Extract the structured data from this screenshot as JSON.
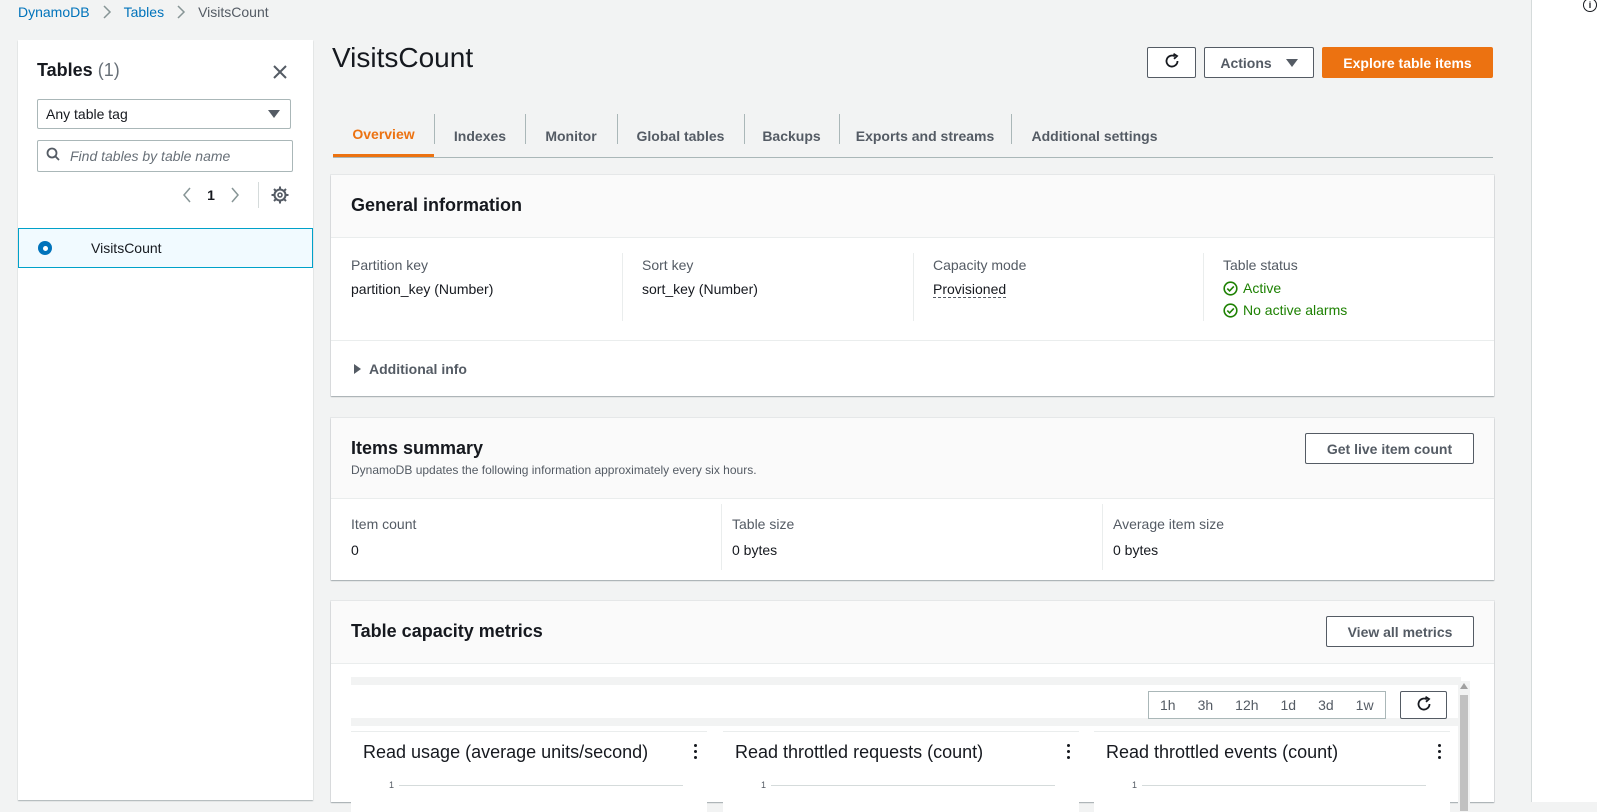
{
  "breadcrumb": {
    "items": [
      "DynamoDB",
      "Tables"
    ],
    "current": "VisitsCount"
  },
  "info_glyph": "i",
  "left_panel": {
    "title": "Tables",
    "count": "(1)",
    "tag_filter": "Any table tag",
    "search_placeholder": "Find tables by table name",
    "page": "1",
    "tables": [
      {
        "name": "VisitsCount",
        "selected": true
      }
    ]
  },
  "page": {
    "title": "VisitsCount"
  },
  "header_actions": {
    "actions_label": "Actions",
    "explore_label": "Explore table items"
  },
  "tabs": [
    "Overview",
    "Indexes",
    "Monitor",
    "Global tables",
    "Backups",
    "Exports and streams",
    "Additional settings"
  ],
  "active_tab": "Overview",
  "general_info": {
    "title": "General information",
    "partition_key": {
      "label": "Partition key",
      "value": "partition_key (Number)"
    },
    "sort_key": {
      "label": "Sort key",
      "value": "sort_key (Number)"
    },
    "capacity_mode": {
      "label": "Capacity mode",
      "value": "Provisioned"
    },
    "table_status": {
      "label": "Table status",
      "status": "Active",
      "alarms": "No active alarms"
    },
    "additional_info": "Additional info"
  },
  "items_summary": {
    "title": "Items summary",
    "description": "DynamoDB updates the following information approximately every six hours.",
    "button": "Get live item count",
    "item_count": {
      "label": "Item count",
      "value": "0"
    },
    "table_size": {
      "label": "Table size",
      "value": "0 bytes"
    },
    "avg_item_size": {
      "label": "Average item size",
      "value": "0 bytes"
    }
  },
  "capacity_metrics": {
    "title": "Table capacity metrics",
    "button": "View all metrics",
    "ranges": [
      "1h",
      "3h",
      "12h",
      "1d",
      "3d",
      "1w"
    ],
    "charts": [
      {
        "title": "Read usage (average units/second)",
        "tick": "1"
      },
      {
        "title": "Read throttled requests (count)",
        "tick": "1"
      },
      {
        "title": "Read throttled events (count)",
        "tick": "1"
      }
    ]
  },
  "colors": {
    "accent": "#ec7211",
    "link": "#0073bb",
    "success": "#1d8102",
    "selected_border": "#00a1c9"
  }
}
